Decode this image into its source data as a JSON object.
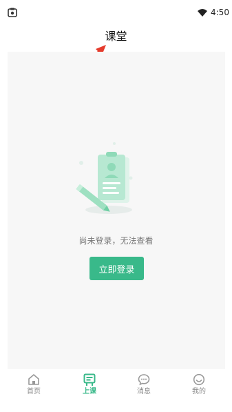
{
  "status_bar": {
    "time": "4:50"
  },
  "page": {
    "title": "课堂"
  },
  "empty_state": {
    "message": "尚未登录，无法查看",
    "login_label": "立即登录"
  },
  "bottom_nav": {
    "items": [
      {
        "label": "首页",
        "icon": "home-icon",
        "active": false
      },
      {
        "label": "上课",
        "icon": "class-board-icon",
        "active": true
      },
      {
        "label": "消息",
        "icon": "chat-bubble-icon",
        "active": false
      },
      {
        "label": "我的",
        "icon": "profile-icon",
        "active": false
      }
    ]
  },
  "colors": {
    "accent": "#39b98a",
    "panel_bg": "#f7f7f7",
    "inactive_nav": "#888888",
    "annotation_arrow": "#e53b2c"
  }
}
